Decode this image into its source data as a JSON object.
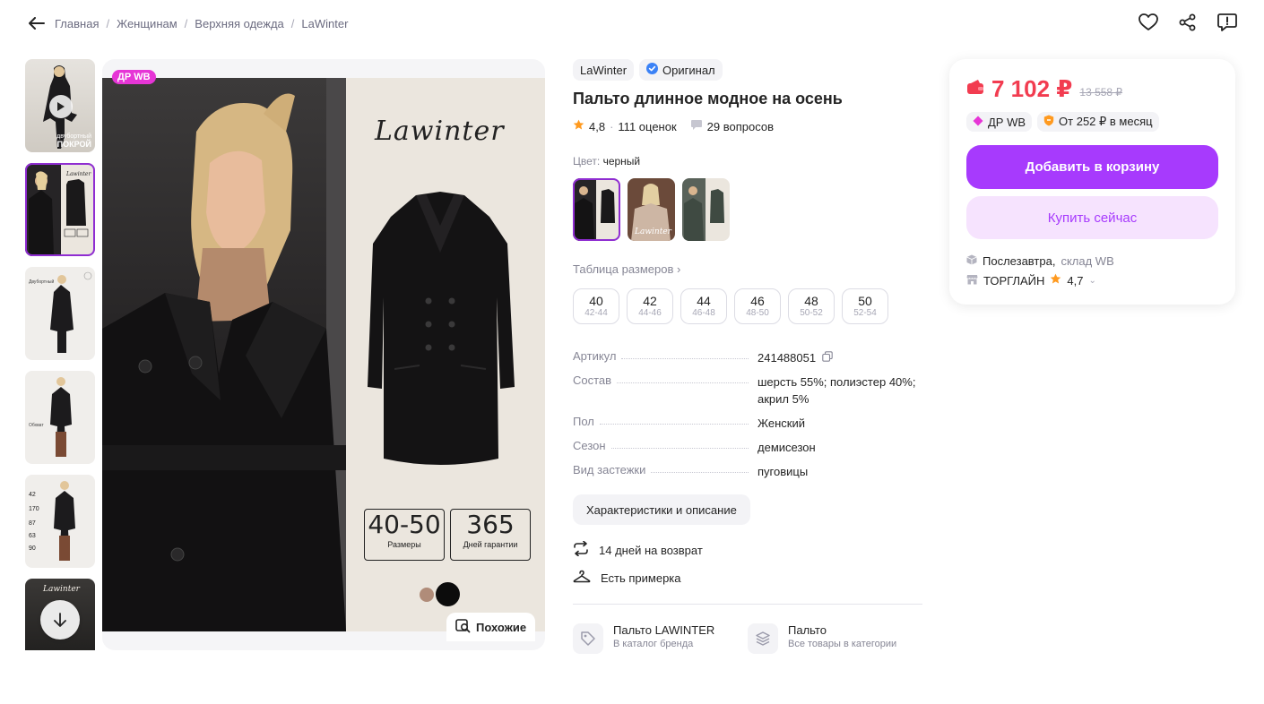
{
  "breadcrumb": {
    "items": [
      "Главная",
      "Женщинам",
      "Верхняя одежда",
      "LaWinter"
    ],
    "separator": "/"
  },
  "header_icons": [
    "heart-icon",
    "share-icon",
    "report-icon"
  ],
  "gallery": {
    "badge": "ДР WB",
    "thumb_caption_small": "двубортный",
    "thumb_caption_big": "ПОКРОЙ",
    "brand_logo": "Lawinter",
    "size_box": {
      "value": "40-50",
      "label": "Размеры"
    },
    "warranty_box": {
      "value": "365",
      "label": "Дней гарантии"
    },
    "similar_label": "Похожие"
  },
  "product": {
    "brand": "LaWinter",
    "original_label": "Оригинал",
    "title": "Пальто длинное модное на осень",
    "rating": "4,8",
    "rating_sep": "·",
    "reviews": "111 оценок",
    "questions": "29 вопросов",
    "color_label": "Цвет:",
    "color_value": "черный",
    "size_table_label": "Таблица размеров",
    "sizes": [
      {
        "n": "40",
        "r": "42-44"
      },
      {
        "n": "42",
        "r": "44-46"
      },
      {
        "n": "44",
        "r": "46-48"
      },
      {
        "n": "46",
        "r": "48-50"
      },
      {
        "n": "48",
        "r": "50-52"
      },
      {
        "n": "50",
        "r": "52-54"
      }
    ],
    "specs": [
      {
        "key": "Артикул",
        "value": "241488051"
      },
      {
        "key": "Состав",
        "value": "шерсть 55%; полиэстер 40%; акрил 5%"
      },
      {
        "key": "Пол",
        "value": "Женский"
      },
      {
        "key": "Сезон",
        "value": "демисезон"
      },
      {
        "key": "Вид застежки",
        "value": "пуговицы"
      }
    ],
    "characteristics_button": "Характеристики и описание",
    "perks": [
      "14 дней на возврат",
      "Есть примерка"
    ],
    "links": [
      {
        "title": "Пальто LAWINTER",
        "sub": "В каталог бренда"
      },
      {
        "title": "Пальто",
        "sub": "Все товары в категории"
      }
    ]
  },
  "buybox": {
    "price": "7 102 ₽",
    "old_price": "13 558 ₽",
    "badge_drwb": "ДР WB",
    "installment": "От 252 ₽ в месяц",
    "add_to_cart": "Добавить в корзину",
    "buy_now": "Купить сейчас",
    "delivery": "Послезавтра,",
    "warehouse": "склад WB",
    "seller": "ТОРГЛАЙН",
    "seller_rating": "4,7"
  },
  "colors": {
    "accent": "#a73afd",
    "price": "#f23c50",
    "badge": "#e635d6"
  }
}
